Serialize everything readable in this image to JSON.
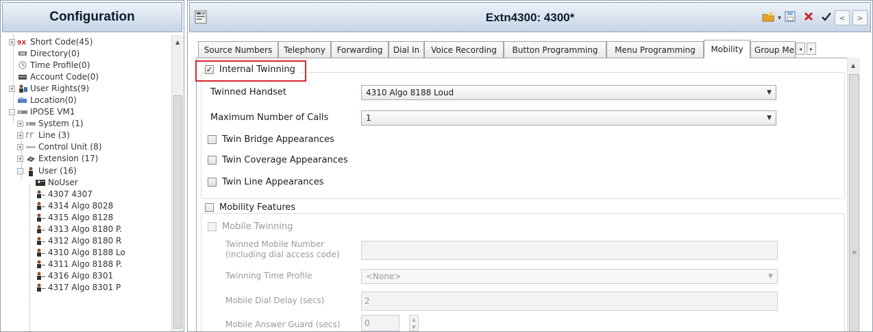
{
  "left_panel": {
    "title": "Configuration",
    "tree": [
      {
        "label": "Short Code(45)",
        "icon": "short-code-icon",
        "expander": "+"
      },
      {
        "label": "Directory(0)",
        "icon": "directory-icon",
        "expander": ""
      },
      {
        "label": "Time Profile(0)",
        "icon": "clock-icon",
        "expander": ""
      },
      {
        "label": "Account Code(0)",
        "icon": "account-code-icon",
        "expander": ""
      },
      {
        "label": "User Rights(9)",
        "icon": "user-rights-icon",
        "expander": "+"
      },
      {
        "label": "Location(0)",
        "icon": "location-icon",
        "expander": ""
      },
      {
        "label": "IPOSE VM1",
        "icon": "server-icon",
        "expander": "-"
      },
      {
        "label": "System (1)",
        "icon": "system-icon",
        "expander": "+"
      },
      {
        "label": "Line (3)",
        "icon": "line-icon",
        "expander": "+"
      },
      {
        "label": "Control Unit (8)",
        "icon": "control-unit-icon",
        "expander": "+"
      },
      {
        "label": "Extension (17)",
        "icon": "extension-icon",
        "expander": "+"
      },
      {
        "label": "User (16)",
        "icon": "user-icon",
        "expander": "-"
      },
      {
        "label": "NoUser",
        "icon": "no-user-icon",
        "expander": ""
      },
      {
        "label": "4307 4307",
        "icon": "user-icon",
        "expander": ""
      },
      {
        "label": "4314 Algo 8028",
        "icon": "user-icon",
        "expander": ""
      },
      {
        "label": "4315 Algo 8128",
        "icon": "user-icon",
        "expander": ""
      },
      {
        "label": "4313 Algo 8180 P.",
        "icon": "user-icon",
        "expander": ""
      },
      {
        "label": "4312 Algo 8180 R",
        "icon": "user-icon",
        "expander": ""
      },
      {
        "label": "4310 Algo 8188 Lo",
        "icon": "user-icon",
        "expander": ""
      },
      {
        "label": "4311 Algo 8188 P.",
        "icon": "user-icon",
        "expander": ""
      },
      {
        "label": "4316 Algo 8301",
        "icon": "user-icon",
        "expander": ""
      },
      {
        "label": "4317 Algo 8301 P",
        "icon": "user-icon",
        "expander": ""
      }
    ]
  },
  "editor": {
    "title": "Extn4300: 4300*",
    "toolbar": {
      "new_icon": "new-item-icon",
      "save_icon": "save-icon",
      "delete_icon": "delete-icon",
      "ok_icon": "checkmark-icon",
      "prev_label": "<",
      "next_label": ">"
    },
    "tabs": [
      {
        "label": "Source Numbers"
      },
      {
        "label": "Telephony"
      },
      {
        "label": "Forwarding"
      },
      {
        "label": "Dial In"
      },
      {
        "label": "Voice Recording"
      },
      {
        "label": "Button Programming"
      },
      {
        "label": "Menu Programming"
      },
      {
        "label": "Mobility"
      },
      {
        "label": "Group Me"
      }
    ],
    "active_tab": "Mobility",
    "mobility": {
      "internal_twinning": {
        "label": "Internal Twinning",
        "checked": true
      },
      "twinned_handset": {
        "label": "Twinned Handset",
        "value": "4310 Algo 8188 Loud"
      },
      "max_calls": {
        "label": "Maximum Number of Calls",
        "value": "1"
      },
      "twin_bridge": {
        "label": "Twin Bridge Appearances",
        "checked": false
      },
      "twin_coverage": {
        "label": "Twin Coverage Appearances",
        "checked": false
      },
      "twin_line": {
        "label": "Twin Line Appearances",
        "checked": false
      },
      "mobility_features": {
        "label": "Mobility Features",
        "checked": false
      },
      "mobile_twinning": {
        "label": "Mobile Twinning",
        "checked": false
      },
      "twinned_mobile_number": {
        "label_line1": "Twinned Mobile Number",
        "label_line2": "(including dial access code)",
        "value": ""
      },
      "twinning_time_profile": {
        "label": "Twinning Time Profile",
        "value": "<None>"
      },
      "mobile_dial_delay": {
        "label": "Mobile Dial Delay (secs)",
        "value": "2"
      },
      "mobile_answer_guard": {
        "label": "Mobile Answer Guard (secs)",
        "value": "0"
      }
    }
  },
  "colors": {
    "highlight": "#d9252e",
    "header_gradient_top": "#ecf2f9",
    "header_gradient_bottom": "#c8d5e6"
  }
}
